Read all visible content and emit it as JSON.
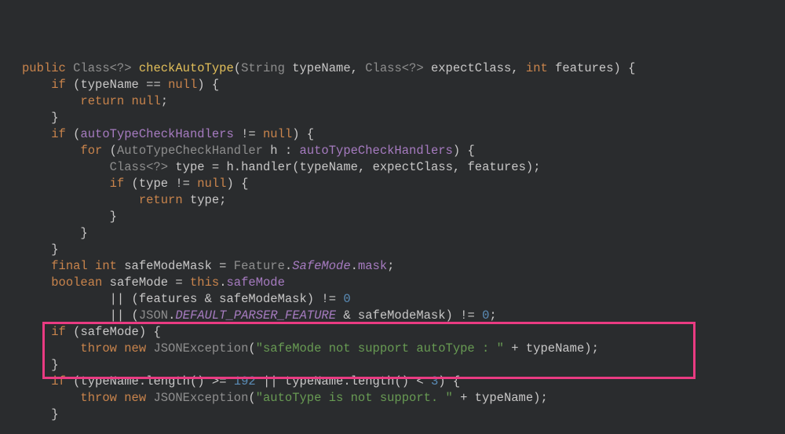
{
  "language": "java",
  "highlight": {
    "first_line_index": 18,
    "last_line_index": 20,
    "color": "#e93b82"
  },
  "lines": [
    {
      "i": 0,
      "indent": 0,
      "segs": [
        {
          "t": "public ",
          "c": "kw"
        },
        {
          "t": "Class<?> ",
          "c": "type"
        },
        {
          "t": "checkAutoType",
          "c": "mdef"
        },
        {
          "t": "(",
          "c": "punc"
        },
        {
          "t": "String ",
          "c": "type"
        },
        {
          "t": "typeName",
          "c": "name"
        },
        {
          "t": ", ",
          "c": "punc"
        },
        {
          "t": "Class<?> ",
          "c": "type"
        },
        {
          "t": "expectClass",
          "c": "name"
        },
        {
          "t": ", ",
          "c": "punc"
        },
        {
          "t": "int ",
          "c": "kw"
        },
        {
          "t": "features",
          "c": "name"
        },
        {
          "t": ") {",
          "c": "punc"
        }
      ]
    },
    {
      "i": 1,
      "indent": 1,
      "segs": [
        {
          "t": "if ",
          "c": "kw"
        },
        {
          "t": "(",
          "c": "punc"
        },
        {
          "t": "typeName ",
          "c": "name"
        },
        {
          "t": "== ",
          "c": "op"
        },
        {
          "t": "null",
          "c": "boolkw"
        },
        {
          "t": ") {",
          "c": "punc"
        }
      ]
    },
    {
      "i": 2,
      "indent": 2,
      "segs": [
        {
          "t": "return ",
          "c": "kw"
        },
        {
          "t": "null",
          "c": "boolkw"
        },
        {
          "t": ";",
          "c": "punc"
        }
      ]
    },
    {
      "i": 3,
      "indent": 1,
      "segs": [
        {
          "t": "}",
          "c": "punc"
        }
      ]
    },
    {
      "i": 4,
      "indent": 0,
      "segs": [
        {
          "t": "",
          "c": "punc"
        }
      ]
    },
    {
      "i": 5,
      "indent": 1,
      "segs": [
        {
          "t": "if ",
          "c": "kw"
        },
        {
          "t": "(",
          "c": "punc"
        },
        {
          "t": "autoTypeCheckHandlers ",
          "c": "field"
        },
        {
          "t": "!= ",
          "c": "op"
        },
        {
          "t": "null",
          "c": "boolkw"
        },
        {
          "t": ") {",
          "c": "punc"
        }
      ]
    },
    {
      "i": 6,
      "indent": 2,
      "segs": [
        {
          "t": "for ",
          "c": "kw"
        },
        {
          "t": "(",
          "c": "punc"
        },
        {
          "t": "AutoTypeCheckHandler ",
          "c": "type"
        },
        {
          "t": "h ",
          "c": "name"
        },
        {
          "t": ": ",
          "c": "punc"
        },
        {
          "t": "autoTypeCheckHandlers",
          "c": "field"
        },
        {
          "t": ") {",
          "c": "punc"
        }
      ]
    },
    {
      "i": 7,
      "indent": 3,
      "segs": [
        {
          "t": "Class<?> ",
          "c": "type"
        },
        {
          "t": "type ",
          "c": "name"
        },
        {
          "t": "= ",
          "c": "op"
        },
        {
          "t": "h",
          "c": "name"
        },
        {
          "t": ".",
          "c": "punc"
        },
        {
          "t": "handler",
          "c": "call"
        },
        {
          "t": "(",
          "c": "punc"
        },
        {
          "t": "typeName",
          "c": "name"
        },
        {
          "t": ", ",
          "c": "punc"
        },
        {
          "t": "expectClass",
          "c": "name"
        },
        {
          "t": ", ",
          "c": "punc"
        },
        {
          "t": "features",
          "c": "name"
        },
        {
          "t": ");",
          "c": "punc"
        }
      ]
    },
    {
      "i": 8,
      "indent": 3,
      "segs": [
        {
          "t": "if ",
          "c": "kw"
        },
        {
          "t": "(",
          "c": "punc"
        },
        {
          "t": "type ",
          "c": "name"
        },
        {
          "t": "!= ",
          "c": "op"
        },
        {
          "t": "null",
          "c": "boolkw"
        },
        {
          "t": ") {",
          "c": "punc"
        }
      ]
    },
    {
      "i": 9,
      "indent": 4,
      "segs": [
        {
          "t": "return ",
          "c": "kw"
        },
        {
          "t": "type",
          "c": "name"
        },
        {
          "t": ";",
          "c": "punc"
        }
      ]
    },
    {
      "i": 10,
      "indent": 3,
      "segs": [
        {
          "t": "}",
          "c": "punc"
        }
      ]
    },
    {
      "i": 11,
      "indent": 2,
      "segs": [
        {
          "t": "}",
          "c": "punc"
        }
      ]
    },
    {
      "i": 12,
      "indent": 1,
      "segs": [
        {
          "t": "}",
          "c": "punc"
        }
      ]
    },
    {
      "i": 13,
      "indent": 0,
      "segs": [
        {
          "t": "",
          "c": "punc"
        }
      ]
    },
    {
      "i": 14,
      "indent": 1,
      "segs": [
        {
          "t": "final ",
          "c": "kw"
        },
        {
          "t": "int ",
          "c": "kw"
        },
        {
          "t": "safeModeMask ",
          "c": "name"
        },
        {
          "t": "= ",
          "c": "op"
        },
        {
          "t": "Feature",
          "c": "type"
        },
        {
          "t": ".",
          "c": "punc"
        },
        {
          "t": "SafeMode",
          "c": "static"
        },
        {
          "t": ".",
          "c": "punc"
        },
        {
          "t": "mask",
          "c": "field"
        },
        {
          "t": ";",
          "c": "punc"
        }
      ]
    },
    {
      "i": 15,
      "indent": 1,
      "segs": [
        {
          "t": "boolean ",
          "c": "kw"
        },
        {
          "t": "safeMode ",
          "c": "name"
        },
        {
          "t": "= ",
          "c": "op"
        },
        {
          "t": "this",
          "c": "boolkw"
        },
        {
          "t": ".",
          "c": "punc"
        },
        {
          "t": "safeMode",
          "c": "field"
        }
      ]
    },
    {
      "i": 16,
      "indent": 3,
      "segs": [
        {
          "t": "|| ",
          "c": "op"
        },
        {
          "t": "(",
          "c": "punc"
        },
        {
          "t": "features ",
          "c": "name"
        },
        {
          "t": "& ",
          "c": "op"
        },
        {
          "t": "safeModeMask",
          "c": "name"
        },
        {
          "t": ") ",
          "c": "punc"
        },
        {
          "t": "!= ",
          "c": "op"
        },
        {
          "t": "0",
          "c": "num"
        }
      ]
    },
    {
      "i": 17,
      "indent": 3,
      "segs": [
        {
          "t": "|| ",
          "c": "op"
        },
        {
          "t": "(",
          "c": "punc"
        },
        {
          "t": "JSON",
          "c": "type"
        },
        {
          "t": ".",
          "c": "punc"
        },
        {
          "t": "DEFAULT_PARSER_FEATURE",
          "c": "static"
        },
        {
          "t": " & ",
          "c": "op"
        },
        {
          "t": "safeModeMask",
          "c": "name"
        },
        {
          "t": ") ",
          "c": "punc"
        },
        {
          "t": "!= ",
          "c": "op"
        },
        {
          "t": "0",
          "c": "num"
        },
        {
          "t": ";",
          "c": "punc"
        }
      ]
    },
    {
      "i": 18,
      "indent": 1,
      "segs": [
        {
          "t": "if ",
          "c": "kw"
        },
        {
          "t": "(",
          "c": "punc"
        },
        {
          "t": "safeMode",
          "c": "name"
        },
        {
          "t": ") {",
          "c": "punc"
        }
      ]
    },
    {
      "i": 19,
      "indent": 2,
      "segs": [
        {
          "t": "throw ",
          "c": "kw"
        },
        {
          "t": "new ",
          "c": "kw"
        },
        {
          "t": "JSONException",
          "c": "type"
        },
        {
          "t": "(",
          "c": "punc"
        },
        {
          "t": "\"safeMode not support autoType : \"",
          "c": "str"
        },
        {
          "t": " + ",
          "c": "op"
        },
        {
          "t": "typeName",
          "c": "name"
        },
        {
          "t": ");",
          "c": "punc"
        }
      ]
    },
    {
      "i": 20,
      "indent": 1,
      "segs": [
        {
          "t": "}",
          "c": "punc"
        }
      ]
    },
    {
      "i": 21,
      "indent": 0,
      "segs": [
        {
          "t": "",
          "c": "punc"
        }
      ]
    },
    {
      "i": 22,
      "indent": 1,
      "segs": [
        {
          "t": "if ",
          "c": "kw"
        },
        {
          "t": "(",
          "c": "punc"
        },
        {
          "t": "typeName",
          "c": "name"
        },
        {
          "t": ".",
          "c": "punc"
        },
        {
          "t": "length",
          "c": "call"
        },
        {
          "t": "() ",
          "c": "punc"
        },
        {
          "t": ">= ",
          "c": "op"
        },
        {
          "t": "192 ",
          "c": "num"
        },
        {
          "t": "|| ",
          "c": "op"
        },
        {
          "t": "typeName",
          "c": "name"
        },
        {
          "t": ".",
          "c": "punc"
        },
        {
          "t": "length",
          "c": "call"
        },
        {
          "t": "() ",
          "c": "punc"
        },
        {
          "t": "< ",
          "c": "op"
        },
        {
          "t": "3",
          "c": "num"
        },
        {
          "t": ") {",
          "c": "punc"
        }
      ]
    },
    {
      "i": 23,
      "indent": 2,
      "segs": [
        {
          "t": "throw ",
          "c": "kw"
        },
        {
          "t": "new ",
          "c": "kw"
        },
        {
          "t": "JSONException",
          "c": "type"
        },
        {
          "t": "(",
          "c": "punc"
        },
        {
          "t": "\"autoType is not support. \"",
          "c": "str"
        },
        {
          "t": " + ",
          "c": "op"
        },
        {
          "t": "typeName",
          "c": "name"
        },
        {
          "t": ");",
          "c": "punc"
        }
      ]
    },
    {
      "i": 24,
      "indent": 1,
      "segs": [
        {
          "t": "}",
          "c": "punc"
        }
      ]
    }
  ]
}
